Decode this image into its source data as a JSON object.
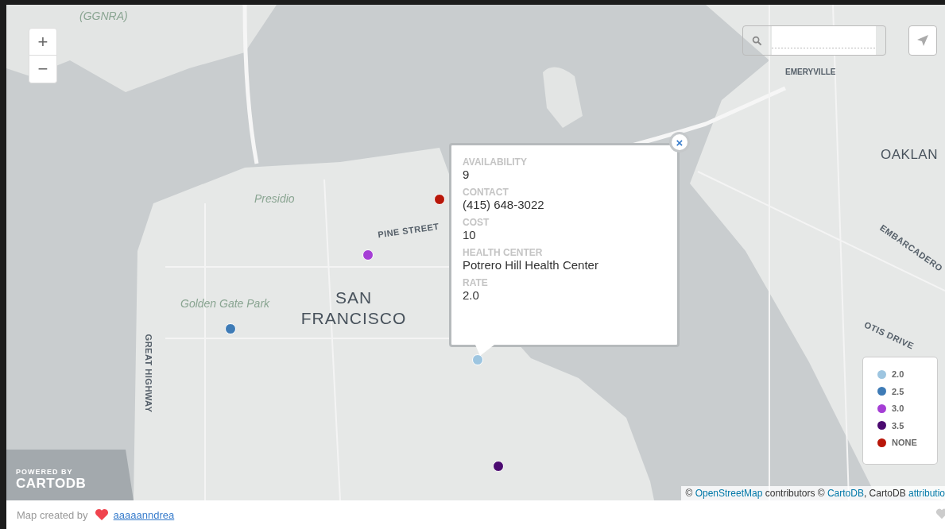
{
  "map": {
    "zoom_in": "+",
    "zoom_out": "−",
    "labels": [
      {
        "text": "(GGNRA)",
        "kind": "park"
      },
      {
        "text": "Presidio",
        "kind": "park"
      },
      {
        "text": "PINE STREET",
        "kind": "street"
      },
      {
        "text": "Golden Gate Park",
        "kind": "park"
      },
      {
        "text": "SAN FRANCISCO",
        "kind": "city"
      },
      {
        "text": "GREAT HIGHWAY",
        "kind": "street"
      },
      {
        "text": "EMERYVILLE",
        "kind": "town"
      },
      {
        "text": "OAKLAN",
        "kind": "city"
      },
      {
        "text": "EMBARCADERO",
        "kind": "street"
      },
      {
        "text": "OTIS DRIVE",
        "kind": "street"
      }
    ],
    "markers": [
      {
        "color": "#b81609"
      },
      {
        "color": "#a53ed5"
      },
      {
        "color": "#3e7bb6"
      },
      {
        "color": "#9dc5e0"
      },
      {
        "color": "#4b0a70"
      }
    ],
    "popup": {
      "close": "×",
      "fields": [
        {
          "label": "AVAILABILITY",
          "value": "9"
        },
        {
          "label": "CONTACT",
          "value": "(415) 648-3022"
        },
        {
          "label": "COST",
          "value": "10"
        },
        {
          "label": "HEALTH CENTER",
          "value": "Potrero Hill Health Center"
        },
        {
          "label": "RATE",
          "value": "2.0"
        }
      ]
    },
    "legend": [
      {
        "label": "2.0",
        "color": "#9dc5e0"
      },
      {
        "label": "2.5",
        "color": "#3e7bb6"
      },
      {
        "label": "3.0",
        "color": "#a53ed5"
      },
      {
        "label": "3.5",
        "color": "#4b0a70"
      },
      {
        "label": "NONE",
        "color": "#b81609"
      }
    ],
    "powered_by": "POWERED BY",
    "brand": "CARTODB",
    "attribution": [
      {
        "kind": "text",
        "text": "© "
      },
      {
        "kind": "link",
        "text": "OpenStreetMap"
      },
      {
        "kind": "text",
        "text": " contributors © "
      },
      {
        "kind": "link",
        "text": "CartoDB"
      },
      {
        "kind": "text",
        "text": ", CartoDB "
      },
      {
        "kind": "link",
        "text": "attributio"
      }
    ]
  },
  "footer": {
    "created_by": "Map created by",
    "author": "aaaaanndrea"
  }
}
